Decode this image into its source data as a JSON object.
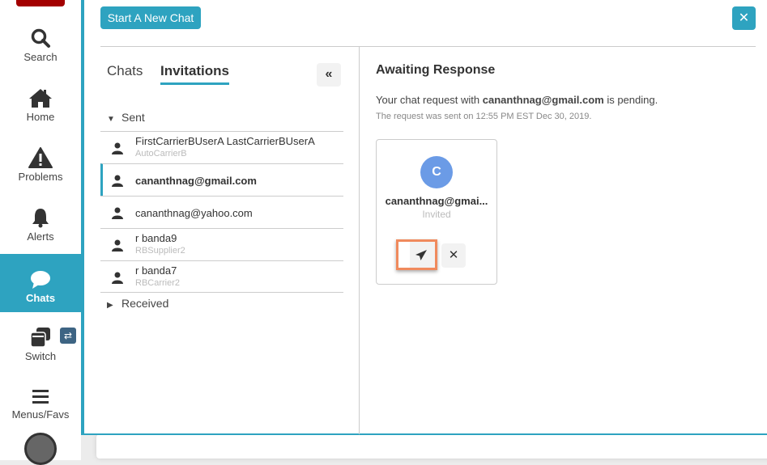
{
  "sidebar": {
    "items": [
      {
        "label": "Search",
        "icon": "search-icon"
      },
      {
        "label": "Home",
        "icon": "home-icon"
      },
      {
        "label": "Problems",
        "icon": "warning-icon"
      },
      {
        "label": "Alerts",
        "icon": "bell-icon"
      },
      {
        "label": "Chats",
        "icon": "chat-bubble-icon",
        "active": true
      },
      {
        "label": "Switch",
        "icon": "windows-icon"
      },
      {
        "label": "Menus/Favs",
        "icon": "hamburger-icon"
      }
    ],
    "switch_badge": "⇄"
  },
  "header": {
    "start_chat_label": "Start A New Chat",
    "close_label": "✕"
  },
  "tabs": [
    {
      "label": "Chats"
    },
    {
      "label": "Invitations",
      "active": true
    }
  ],
  "collapse_label": "«",
  "groups": {
    "sent": "Sent",
    "received": "Received"
  },
  "sent": [
    {
      "name": "FirstCarrierBUserA LastCarrierBUserA",
      "sub": "AutoCarrierB"
    },
    {
      "name": "cananthnag@gmail.com",
      "sub": "",
      "selected": true
    },
    {
      "name": "cananthnag@yahoo.com",
      "sub": ""
    },
    {
      "name": "r banda9",
      "sub": "RBSupplier2"
    },
    {
      "name": "r banda7",
      "sub": "RBCarrier2"
    }
  ],
  "detail": {
    "title": "Awaiting Response",
    "msg_pre": "Your chat request with ",
    "msg_email": "cananthnag@gmail.com",
    "msg_post": " is pending.",
    "sent_on": "The request was sent on 12:55 PM EST Dec 30, 2019.",
    "card": {
      "initial": "C",
      "name": "cananthnag@gmai...",
      "status": "Invited",
      "remove_label": "✕"
    }
  },
  "colors": {
    "accent": "#2ea3c0",
    "avatar": "#6b9be6",
    "highlight": "#f08a5d"
  }
}
